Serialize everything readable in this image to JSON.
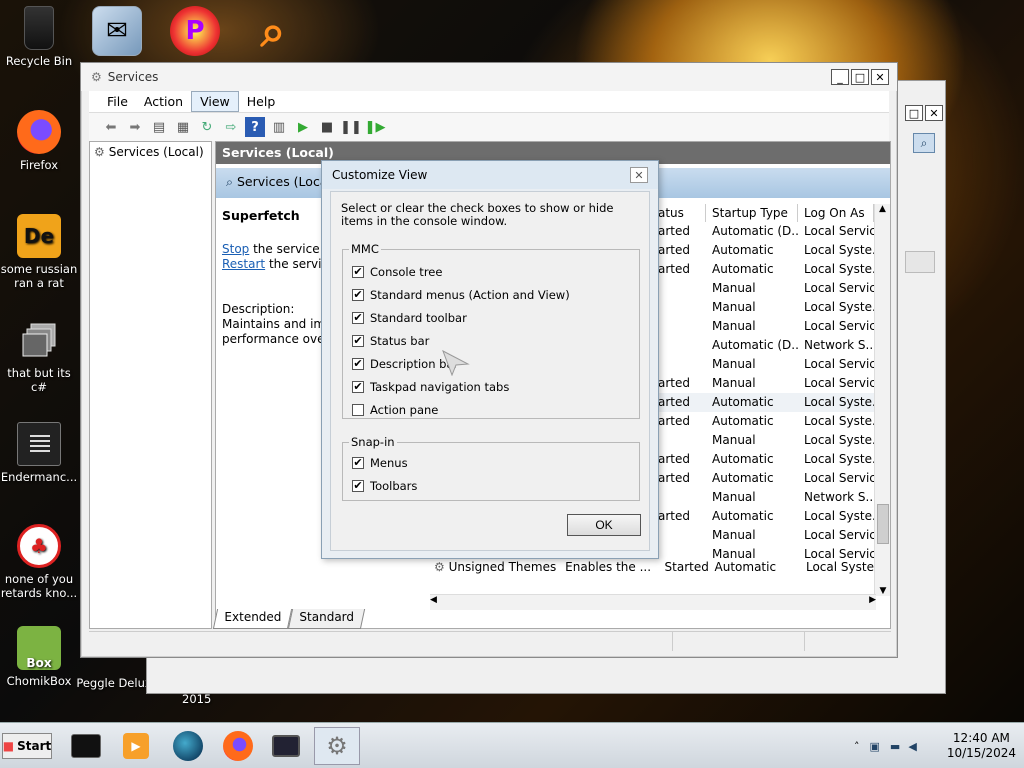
{
  "desktop": {
    "icons": [
      {
        "label": "Recycle Bin"
      },
      {
        "label": "Firefox"
      },
      {
        "label": "some russian ran a rat"
      },
      {
        "label": "that but its c#"
      },
      {
        "label": "Endermanc..."
      },
      {
        "label": "none of you retards kno..."
      },
      {
        "label": "ChomikBox"
      },
      {
        "label": "Peggle Delux"
      }
    ],
    "year_label": "2015"
  },
  "services_window": {
    "title": "Services",
    "menu": [
      "File",
      "Action",
      "View",
      "Help"
    ],
    "tree_item": "Services (Local)",
    "pane_header": "Services (Local)",
    "blue_header": "Services (Loca",
    "selected_service": "Superfetch",
    "stop_link": "Stop",
    "stop_rest": " the service",
    "restart_link": "Restart",
    "restart_rest": " the service",
    "description_label": "Description:",
    "description_line1": "Maintains and imp",
    "description_line2": "performance over t",
    "columns": [
      "atus",
      "Startup Type",
      "Log On As"
    ],
    "rows": [
      [
        "arted",
        "Automatic (D...",
        "Local Service"
      ],
      [
        "arted",
        "Automatic",
        "Local Syste..."
      ],
      [
        "arted",
        "Automatic",
        "Local Syste..."
      ],
      [
        "",
        "Manual",
        "Local Service"
      ],
      [
        "",
        "Manual",
        "Local Syste..."
      ],
      [
        "",
        "Manual",
        "Local Service"
      ],
      [
        "",
        "Automatic (D...",
        "Network S..."
      ],
      [
        "",
        "Manual",
        "Local Service"
      ],
      [
        "arted",
        "Manual",
        "Local Service"
      ],
      [
        "arted",
        "Automatic",
        "Local Syste..."
      ],
      [
        "arted",
        "Automatic",
        "Local Syste..."
      ],
      [
        "",
        "Manual",
        "Local Syste..."
      ],
      [
        "arted",
        "Automatic",
        "Local Syste..."
      ],
      [
        "arted",
        "Automatic",
        "Local Service"
      ],
      [
        "",
        "Manual",
        "Network S..."
      ],
      [
        "arted",
        "Automatic",
        "Local Syste..."
      ],
      [
        "",
        "Manual",
        "Local Service"
      ],
      [
        "",
        "Manual",
        "Local Service"
      ]
    ],
    "last_row": {
      "name": "Unsigned Themes",
      "description": "Enables the ...",
      "status": "Started",
      "startup": "Automatic",
      "logon": "Local Syste..."
    },
    "tabs": [
      "Extended",
      "Standard"
    ]
  },
  "dialog": {
    "title": "Customize View",
    "description": "Select or clear the check boxes to show or hide items in the console window.",
    "mmc_legend": "MMC",
    "mmc_items": [
      {
        "label": "Console tree",
        "checked": true
      },
      {
        "label": "Standard menus (Action and View)",
        "checked": true
      },
      {
        "label": "Standard toolbar",
        "checked": true
      },
      {
        "label": "Status bar",
        "checked": true
      },
      {
        "label": "Description bar",
        "checked": true
      },
      {
        "label": "Taskpad navigation tabs",
        "checked": true
      },
      {
        "label": "Action pane",
        "checked": false
      }
    ],
    "snapin_legend": "Snap-in",
    "snapin_items": [
      {
        "label": "Menus",
        "checked": true
      },
      {
        "label": "Toolbars",
        "checked": true
      }
    ],
    "ok_label": "OK"
  },
  "taskbar": {
    "start_label": "Start",
    "time": "12:40 AM",
    "date": "10/15/2024"
  }
}
